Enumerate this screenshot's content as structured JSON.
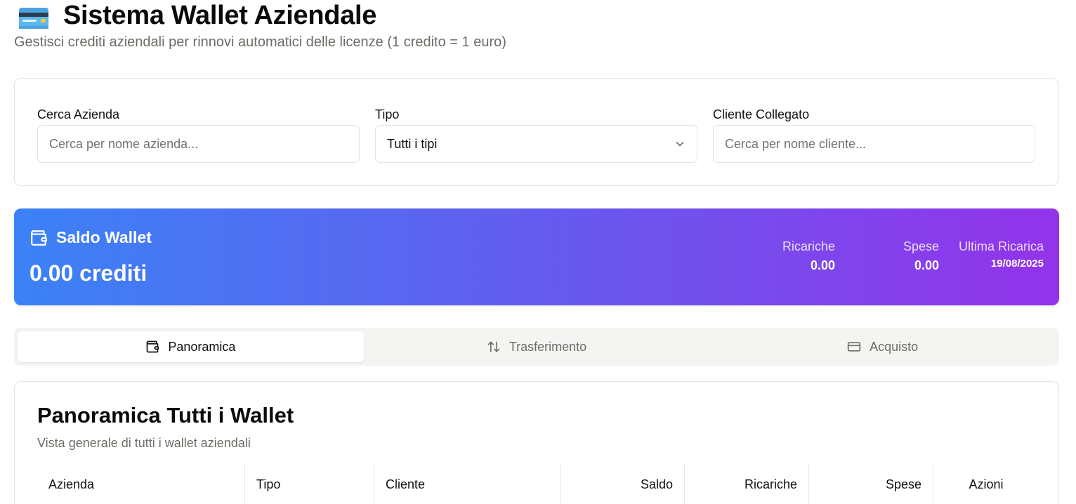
{
  "header": {
    "title": "Sistema Wallet Aziendale",
    "subtitle": "Gestisci crediti aziendali per rinnovi automatici delle licenze (1 credito = 1 euro)",
    "icon": "credit-card-emoji"
  },
  "filters": {
    "company": {
      "label": "Cerca Azienda",
      "placeholder": "Cerca per nome azienda...",
      "value": ""
    },
    "type": {
      "label": "Tipo",
      "value": "Tutti i tipi"
    },
    "client": {
      "label": "Cliente Collegato",
      "placeholder": "Cerca per nome cliente...",
      "value": ""
    }
  },
  "wallet": {
    "title": "Saldo Wallet",
    "balance": "0.00 crediti",
    "stats": {
      "recharges_label": "Ricariche",
      "recharges_value": "0.00",
      "expenses_label": "Spese",
      "expenses_value": "0.00",
      "last_recharge_label": "Ultima Ricarica",
      "last_recharge_value": "19/08/2025"
    },
    "gradient": [
      "#3b82f6",
      "#9333ea"
    ]
  },
  "tabs": [
    {
      "label": "Panoramica",
      "icon": "wallet-icon",
      "active": true
    },
    {
      "label": "Trasferimento",
      "icon": "arrows-up-down-icon",
      "active": false
    },
    {
      "label": "Acquisto",
      "icon": "credit-card-icon",
      "active": false
    }
  ],
  "overview": {
    "title": "Panoramica Tutti i Wallet",
    "subtitle": "Vista generale di tutti i wallet aziendali",
    "columns": [
      "Azienda",
      "Tipo",
      "Cliente",
      "Saldo",
      "Ricariche",
      "Spese",
      "Azioni"
    ]
  }
}
